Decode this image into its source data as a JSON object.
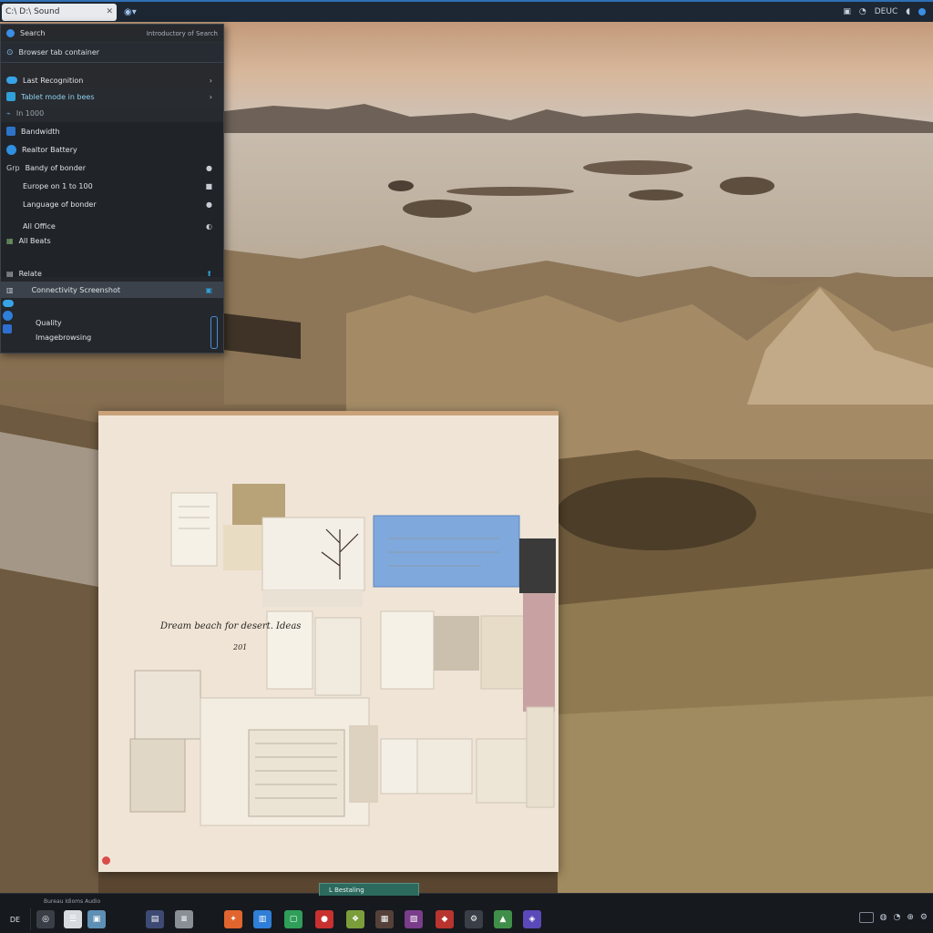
{
  "top_bar": {
    "address_text": "C:\\ D:\\ Sound",
    "right_label": "DEUC",
    "accent": "#2f6fb5"
  },
  "sidebar": {
    "header_label": "Search",
    "header_right": "Introductory of Search",
    "title": "Browser tab container",
    "items": [
      {
        "label": "Last Recognition",
        "trail": "›"
      },
      {
        "label": "Tablet mode in bees",
        "trail": "›"
      },
      {
        "label": "In 1000",
        "trail": ""
      },
      {
        "label": "Bandwidth",
        "trail": ""
      },
      {
        "label": "Realtor Battery",
        "trail": ""
      },
      {
        "label": "Bandy of bonder",
        "trail": ""
      },
      {
        "label": "Europe on 1 to 100",
        "trail": ""
      },
      {
        "label": "Language of bonder",
        "trail": ""
      },
      {
        "label": "All Office",
        "trail": ""
      },
      {
        "label": "All Beats",
        "trail": ""
      },
      {
        "label": "Relate",
        "trail": ""
      },
      {
        "label": "Connectivity Screenshot",
        "trail": ""
      },
      {
        "label": "Quality",
        "trail": ""
      },
      {
        "label": "Imagebrowsing",
        "trail": ""
      }
    ]
  },
  "board": {
    "handwritten_note": "Dream beach for desert. Ideas",
    "note_number": "201"
  },
  "taskbar": {
    "start_label": "DE",
    "caption": "Bureau Idioms Audio",
    "active_tab_label": "L  Bestaling",
    "icons": [
      {
        "name": "settings-circle-icon",
        "glyph": "◎",
        "color": "#3a3f47"
      },
      {
        "name": "document-icon",
        "glyph": "☰",
        "color": "#d7dbe0"
      },
      {
        "name": "photos-icon",
        "glyph": "▣",
        "color": "#5e8fb5"
      },
      {
        "name": "monitor-icon",
        "glyph": "▤",
        "color": "#3d4a73"
      },
      {
        "name": "notes-icon",
        "glyph": "≡",
        "color": "#8a8f96"
      },
      {
        "name": "app-orange-icon",
        "glyph": "✦",
        "color": "#e0652e"
      },
      {
        "name": "app-blue-icon",
        "glyph": "▥",
        "color": "#2f7ed8"
      },
      {
        "name": "app-green-icon",
        "glyph": "▢",
        "color": "#2e9e59"
      },
      {
        "name": "app-red-icon",
        "glyph": "●",
        "color": "#c8312f"
      },
      {
        "name": "app-colorful-icon",
        "glyph": "❖",
        "color": "#7b9e3b"
      },
      {
        "name": "app-dark-icon",
        "glyph": "▦",
        "color": "#55413a"
      },
      {
        "name": "app-purple-icon",
        "glyph": "▧",
        "color": "#7a3d8a"
      },
      {
        "name": "app-red2-icon",
        "glyph": "◆",
        "color": "#b8342f"
      },
      {
        "name": "app-gray-icon",
        "glyph": "⚙",
        "color": "#3a3f47"
      },
      {
        "name": "app-green2-icon",
        "glyph": "▲",
        "color": "#3f8f4a"
      },
      {
        "name": "app-violet-icon",
        "glyph": "◈",
        "color": "#5a49b8"
      }
    ]
  }
}
